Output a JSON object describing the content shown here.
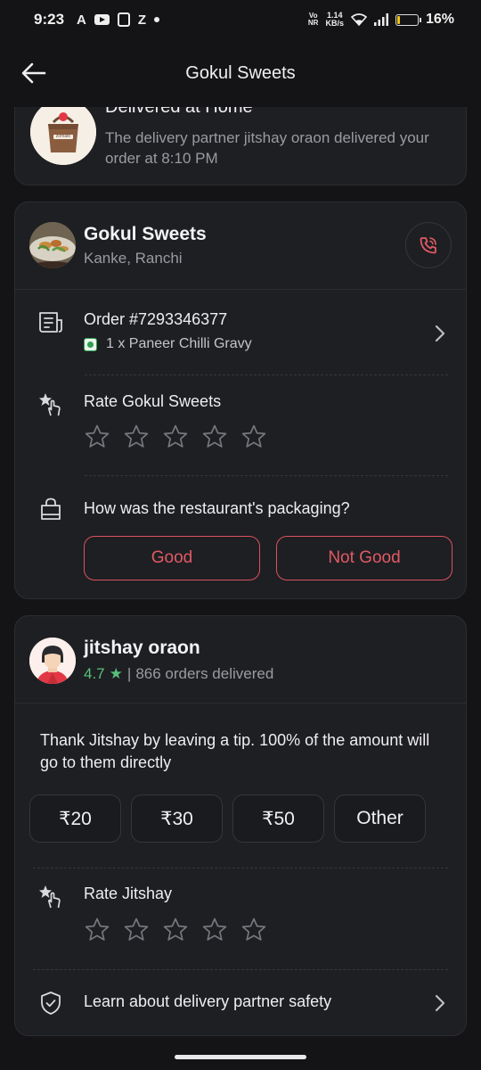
{
  "status_bar": {
    "time": "9:23",
    "left_icons": [
      "arc-app-icon",
      "youtube-icon",
      "calculator-icon",
      "zomato-z-icon",
      "dot-icon"
    ],
    "app_letter_a": "A",
    "app_letter_z": "Z",
    "volte_line1": "Vo",
    "volte_line2": "NR",
    "speed_line1": "1.14",
    "speed_line2": "KB/s",
    "battery": "16%",
    "battery_level": 0.16
  },
  "header": {
    "title": "Gokul Sweets",
    "back_icon": "arrow-left-icon"
  },
  "delivery_status": {
    "heading": "Delivered at Home",
    "description": "The delivery partner jitshay oraon delivered your order at 8:10 PM",
    "bag_label": "zomato"
  },
  "restaurant": {
    "name": "Gokul Sweets",
    "location": "Kanke, Ranchi",
    "order_number": "Order #7293346377",
    "order_item": "1 x Paneer Chilli Gravy",
    "rate_label": "Rate Gokul Sweets",
    "rating_stars": 5,
    "packaging_question": "How was the restaurant's packaging?",
    "packaging_good": "Good",
    "packaging_not_good": "Not Good"
  },
  "rider": {
    "name": "jitshay oraon",
    "rating": "4.7",
    "rating_star": "★",
    "separator": "|",
    "orders_delivered": "866 orders delivered",
    "tip_message": "Thank Jitshay by leaving a tip. 100% of the amount will go to them directly",
    "tips": [
      "₹20",
      "₹30",
      "₹50",
      "Other"
    ],
    "rate_label": "Rate Jitshay",
    "safety_label": "Learn about delivery partner safety"
  },
  "colors": {
    "background": "#141416",
    "card": "#1e1f22",
    "accent_red": "#e05a66",
    "rating_green": "#58c07a",
    "veg_green": "#2fa14f"
  }
}
